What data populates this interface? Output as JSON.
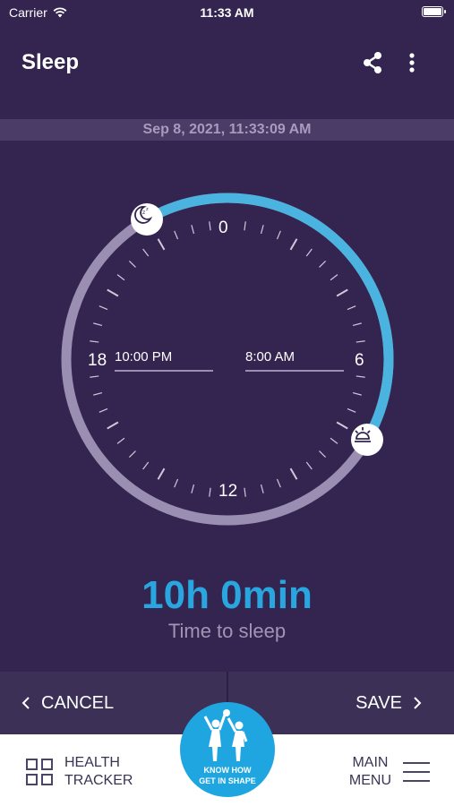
{
  "status_bar": {
    "carrier": "Carrier",
    "time": "11:33 AM"
  },
  "header": {
    "title": "Sleep",
    "share_icon": "share-icon",
    "more_icon": "more-vertical-icon"
  },
  "date_bar": {
    "text": "Sep 8, 2021, 11:33:09 AM"
  },
  "clock": {
    "labels": {
      "top": "0",
      "right": "6",
      "bottom": "12",
      "left": "18"
    },
    "bedtime": "10:00 PM",
    "wake_time": "8:00 AM",
    "bedtime_hour": 22,
    "wake_hour": 8,
    "bedtime_icon": "moon-icon",
    "wake_icon": "sun-icon",
    "colors": {
      "arc_active": "#4bb3e0",
      "arc_inactive": "#9a8fb2"
    }
  },
  "duration": {
    "value": "10h 0min",
    "label": "Time to sleep"
  },
  "actions": {
    "cancel_label": "CANCEL",
    "save_label": "SAVE"
  },
  "bottom_nav": {
    "health_tracker_line1": "HEALTH",
    "health_tracker_line2": "TRACKER",
    "main_menu_line1": "MAIN",
    "main_menu_line2": "MENU",
    "logo_line1": "KNOW HOW",
    "logo_line2": "GET IN SHAPE"
  },
  "colors": {
    "background": "#33254f",
    "accent": "#29a6df"
  }
}
